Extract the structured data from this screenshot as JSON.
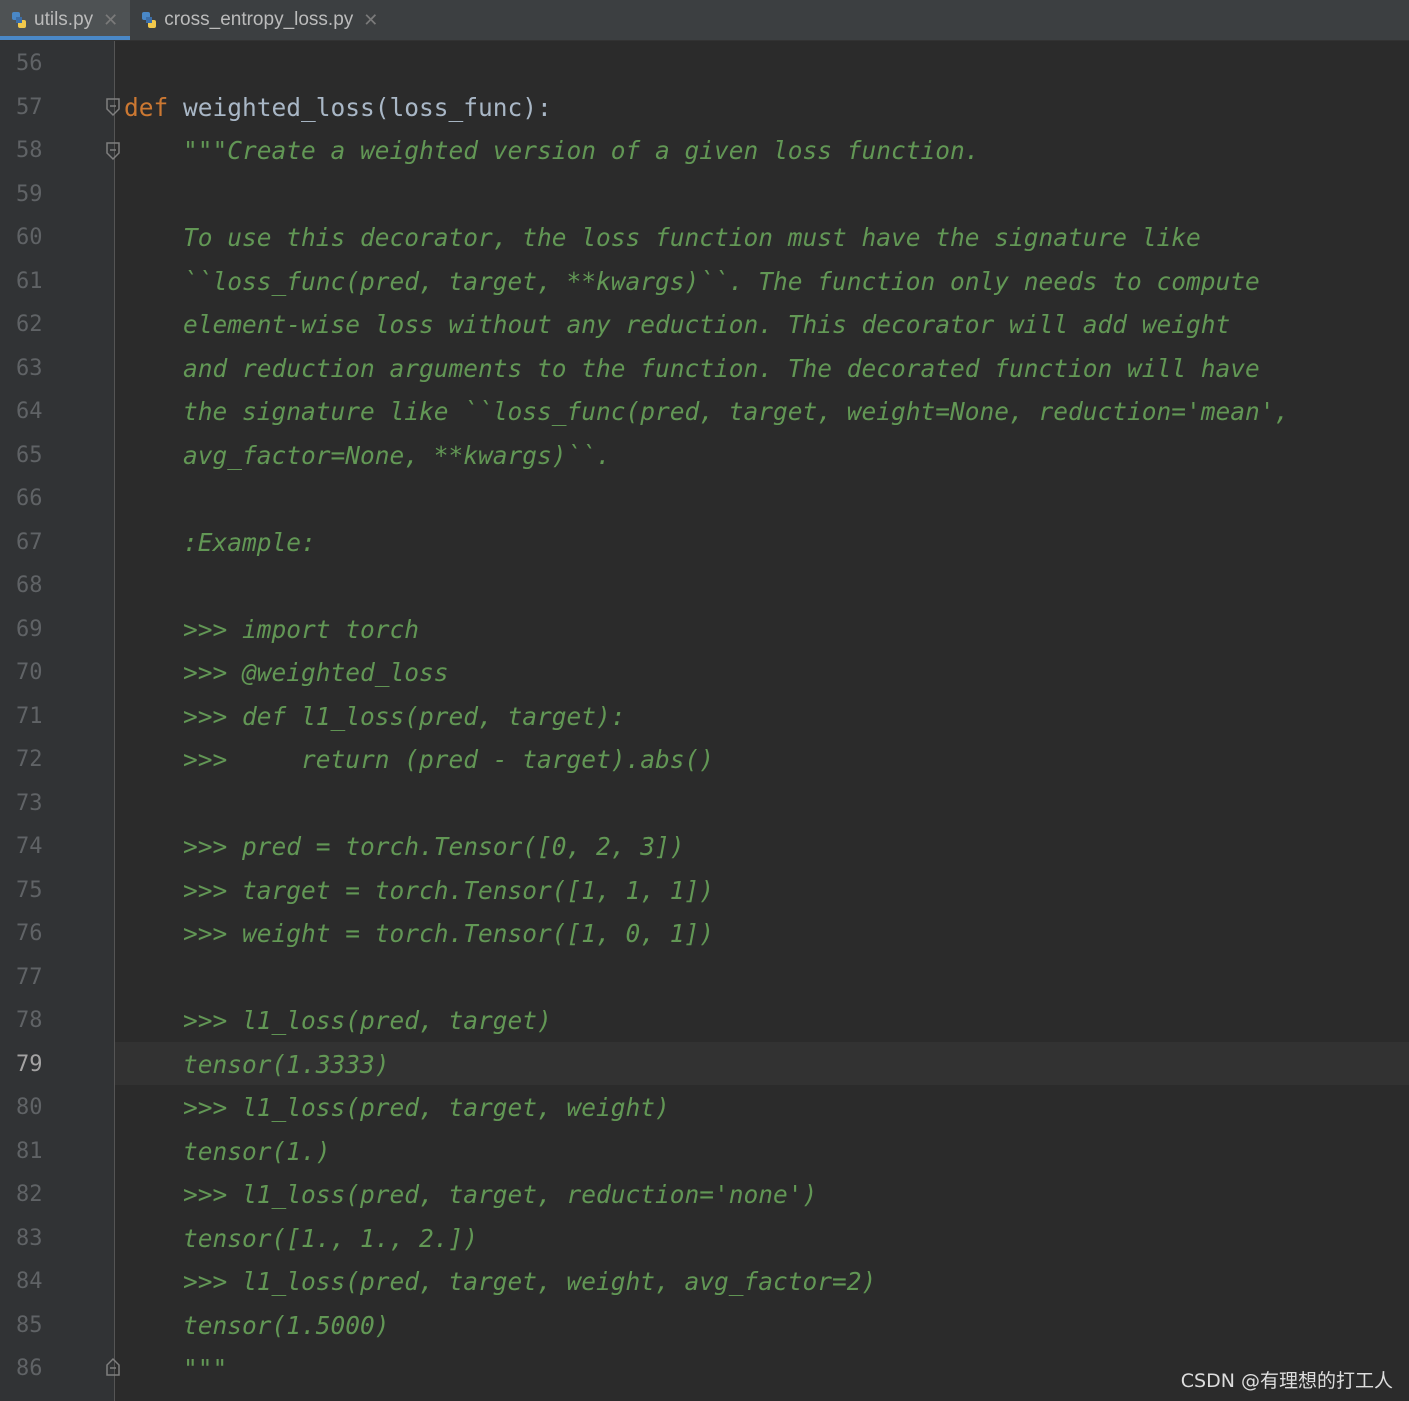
{
  "tabs": [
    {
      "label": "utils.py",
      "active": true
    },
    {
      "label": "cross_entropy_loss.py",
      "active": false
    }
  ],
  "current_line": "79",
  "colors": {
    "keyword": "#cc7832",
    "docstring": "#629755",
    "plain": "#a9b7c6",
    "background": "#2b2b2b",
    "gutter": "#313335"
  },
  "lines": [
    {
      "num": "56",
      "kind": "plain",
      "text": ""
    },
    {
      "num": "57",
      "kind": "def",
      "keyword": "def",
      "text": " weighted_loss(loss_func):"
    },
    {
      "num": "58",
      "kind": "doc",
      "text": "    \"\"\"Create a weighted version of a given loss function."
    },
    {
      "num": "59",
      "kind": "doc",
      "text": ""
    },
    {
      "num": "60",
      "kind": "doc",
      "text": "    To use this decorator, the loss function must have the signature like"
    },
    {
      "num": "61",
      "kind": "doc",
      "text": "    ``loss_func(pred, target, **kwargs)``. The function only needs to compute"
    },
    {
      "num": "62",
      "kind": "doc",
      "text": "    element-wise loss without any reduction. This decorator will add weight"
    },
    {
      "num": "63",
      "kind": "doc",
      "text": "    and reduction arguments to the function. The decorated function will have"
    },
    {
      "num": "64",
      "kind": "doc",
      "text": "    the signature like ``loss_func(pred, target, weight=None, reduction='mean',"
    },
    {
      "num": "65",
      "kind": "doc",
      "text": "    avg_factor=None, **kwargs)``."
    },
    {
      "num": "66",
      "kind": "doc",
      "text": ""
    },
    {
      "num": "67",
      "kind": "doc",
      "text": "    :Example:"
    },
    {
      "num": "68",
      "kind": "doc",
      "text": ""
    },
    {
      "num": "69",
      "kind": "doc",
      "text": "    >>> import torch"
    },
    {
      "num": "70",
      "kind": "doc",
      "text": "    >>> @weighted_loss"
    },
    {
      "num": "71",
      "kind": "doc",
      "text": "    >>> def l1_loss(pred, target):"
    },
    {
      "num": "72",
      "kind": "doc",
      "text": "    >>>     return (pred - target).abs()"
    },
    {
      "num": "73",
      "kind": "doc",
      "text": ""
    },
    {
      "num": "74",
      "kind": "doc",
      "text": "    >>> pred = torch.Tensor([0, 2, 3])"
    },
    {
      "num": "75",
      "kind": "doc",
      "text": "    >>> target = torch.Tensor([1, 1, 1])"
    },
    {
      "num": "76",
      "kind": "doc",
      "text": "    >>> weight = torch.Tensor([1, 0, 1])"
    },
    {
      "num": "77",
      "kind": "doc",
      "text": ""
    },
    {
      "num": "78",
      "kind": "doc",
      "text": "    >>> l1_loss(pred, target)"
    },
    {
      "num": "79",
      "kind": "doc",
      "text": "    tensor(1.3333)"
    },
    {
      "num": "80",
      "kind": "doc",
      "text": "    >>> l1_loss(pred, target, weight)"
    },
    {
      "num": "81",
      "kind": "doc",
      "text": "    tensor(1.)"
    },
    {
      "num": "82",
      "kind": "doc",
      "text": "    >>> l1_loss(pred, target, reduction='none')"
    },
    {
      "num": "83",
      "kind": "doc",
      "text": "    tensor([1., 1., 2.])"
    },
    {
      "num": "84",
      "kind": "doc",
      "text": "    >>> l1_loss(pred, target, weight, avg_factor=2)"
    },
    {
      "num": "85",
      "kind": "doc",
      "text": "    tensor(1.5000)"
    },
    {
      "num": "86",
      "kind": "doc",
      "text": "    \"\"\""
    }
  ],
  "watermark": "CSDN @有理想的打工人"
}
